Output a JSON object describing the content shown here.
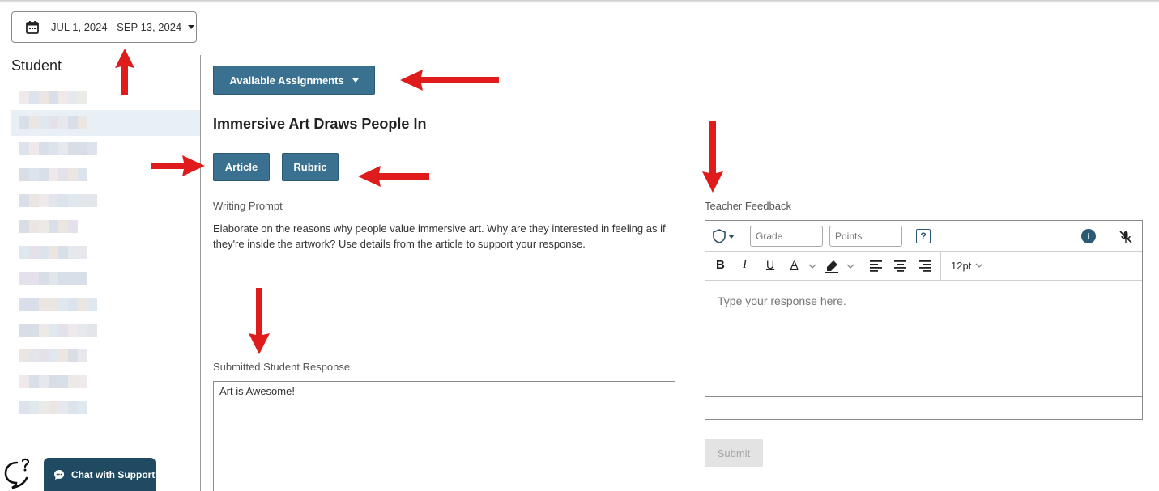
{
  "date_range": {
    "label": "JUL 1, 2024 - SEP 13, 2024",
    "icon": "calendar-icon"
  },
  "sidebar": {
    "heading": "Student",
    "selected_index": 1,
    "student_count": 13
  },
  "assignments_button": {
    "label": "Available Assignments"
  },
  "assignment": {
    "title": "Immersive Art Draws People In",
    "article_label": "Article",
    "rubric_label": "Rubric",
    "prompt_label": "Writing Prompt",
    "prompt_text": "Elaborate on the reasons why people value immersive art. Why are they interested in feeling as if they're inside the artwork? Use details from the article to support your response."
  },
  "response": {
    "label": "Submitted Student Response",
    "text": "Art is Awesome!"
  },
  "feedback": {
    "label": "Teacher Feedback",
    "grade_placeholder": "Grade",
    "points_placeholder": "Points",
    "font_size": "12pt",
    "editor_placeholder": "Type your response here.",
    "submit_label": "Submit"
  },
  "support": {
    "chat_label": "Chat with Support"
  },
  "colors": {
    "primary": "#3a7190",
    "chat": "#1f4a61",
    "annotation_arrow": "#e01b1b"
  }
}
